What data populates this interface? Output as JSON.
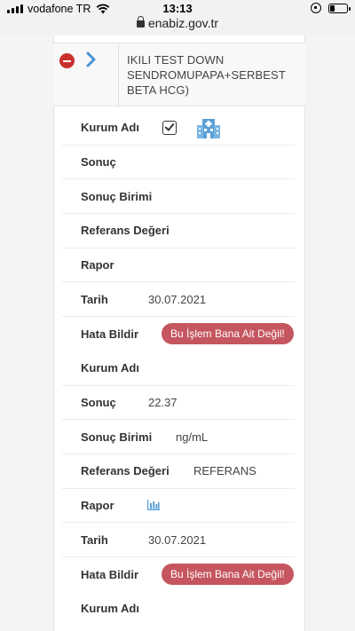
{
  "status_bar": {
    "carrier": "vodafone TR",
    "time": "13:13",
    "url": "enabiz.gov.tr"
  },
  "test": {
    "title": "IKILI TEST DOWN SENDROMUPAPA+SERBEST BETA HCG)"
  },
  "labels": {
    "institution": "Kurum Adı",
    "result": "Sonuç",
    "result_unit": "Sonuç Birimi",
    "reference": "Referans Değeri",
    "report": "Rapor",
    "date": "Tarih",
    "report_error": "Hata Bildir"
  },
  "records": [
    {
      "result": "",
      "unit": "",
      "reference": "",
      "date": "30.07.2021",
      "error_button": "Bu İşlem Bana Ait Değil!"
    },
    {
      "result": "22.37",
      "unit": "ng/mL",
      "reference": "REFERANS",
      "date": "30.07.2021",
      "error_button": "Bu İşlem Bana Ait Değil!"
    }
  ],
  "icons": {
    "remove": "minus-circle-icon",
    "expand": "chevron-right-icon",
    "checkbox": "checkbox-checked-icon",
    "hospital": "hospital-building-icon",
    "report": "bar-chart-icon"
  },
  "colors": {
    "remove": "#c9302c",
    "chevron": "#4a90d9",
    "error_button": "#c5565f",
    "icon_blue": "#5aa0d8"
  }
}
